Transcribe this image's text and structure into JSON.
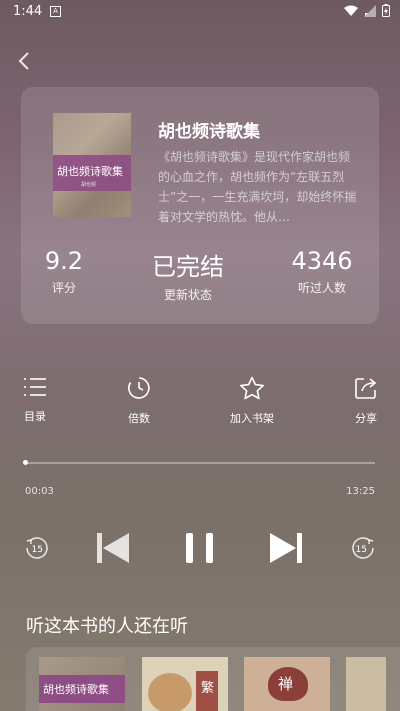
{
  "status": {
    "time": "1:44",
    "notif": "A"
  },
  "book": {
    "title": "胡也频诗歌集",
    "cover_title": "胡也频诗歌集",
    "cover_sub": "胡也频",
    "description": "《胡也频诗歌集》是现代作家胡也频的心血之作，胡也频作为“左联五烈士”之一，一生充满坎坷，却始终怀揣着对文学的热忱。他从…"
  },
  "stats": [
    {
      "value": "9.2",
      "label": "评分"
    },
    {
      "value": "已完结",
      "label": "更新状态"
    },
    {
      "value": "4346",
      "label": "听过人数"
    }
  ],
  "actions": {
    "catalog": "目录",
    "speed": "倍数",
    "shelf": "加入书架",
    "share": "分享"
  },
  "player": {
    "current": "00:03",
    "total": "13:25",
    "progress": 0.004,
    "rewind": "15",
    "forward": "15"
  },
  "recommend": {
    "title": "听这本书的人还在听",
    "items": [
      {
        "cover_text": "胡也频诗歌集"
      },
      {
        "cover_text": "繁"
      },
      {
        "cover_text": "禅"
      },
      {
        "cover_text": ""
      }
    ]
  },
  "colors": {
    "accent_purple": "#8e4d84",
    "text": "#ffffff"
  }
}
